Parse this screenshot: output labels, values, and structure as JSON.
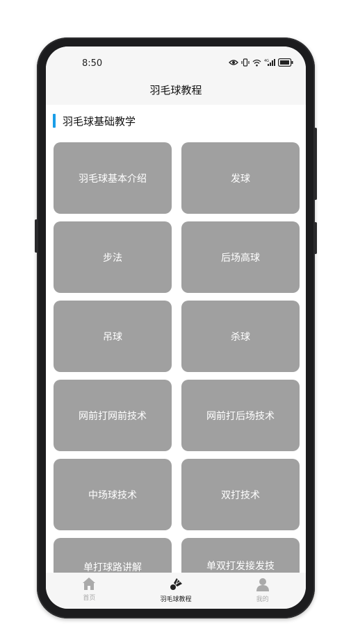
{
  "status_bar": {
    "time": "8:50"
  },
  "header": {
    "title": "羽毛球教程"
  },
  "section": {
    "title": "羽毛球基础教学",
    "accent_color": "#1a9ee8"
  },
  "cards": [
    "羽毛球基本介绍",
    "发球",
    "步法",
    "后场高球",
    "吊球",
    "杀球",
    "网前打网前技术",
    "网前打后场技术",
    "中场球技术",
    "双打技术",
    "单打球路讲解",
    "单双打发接发技"
  ],
  "tabs": [
    {
      "label": "首页",
      "icon": "home-icon",
      "active": false
    },
    {
      "label": "羽毛球教程",
      "icon": "shuttlecock-icon",
      "active": true
    },
    {
      "label": "我的",
      "icon": "user-icon",
      "active": false
    }
  ],
  "colors": {
    "card_background": "#a0a0a0",
    "card_text": "#ffffff",
    "tab_inactive": "#aaaaaa",
    "tab_active": "#222222"
  }
}
